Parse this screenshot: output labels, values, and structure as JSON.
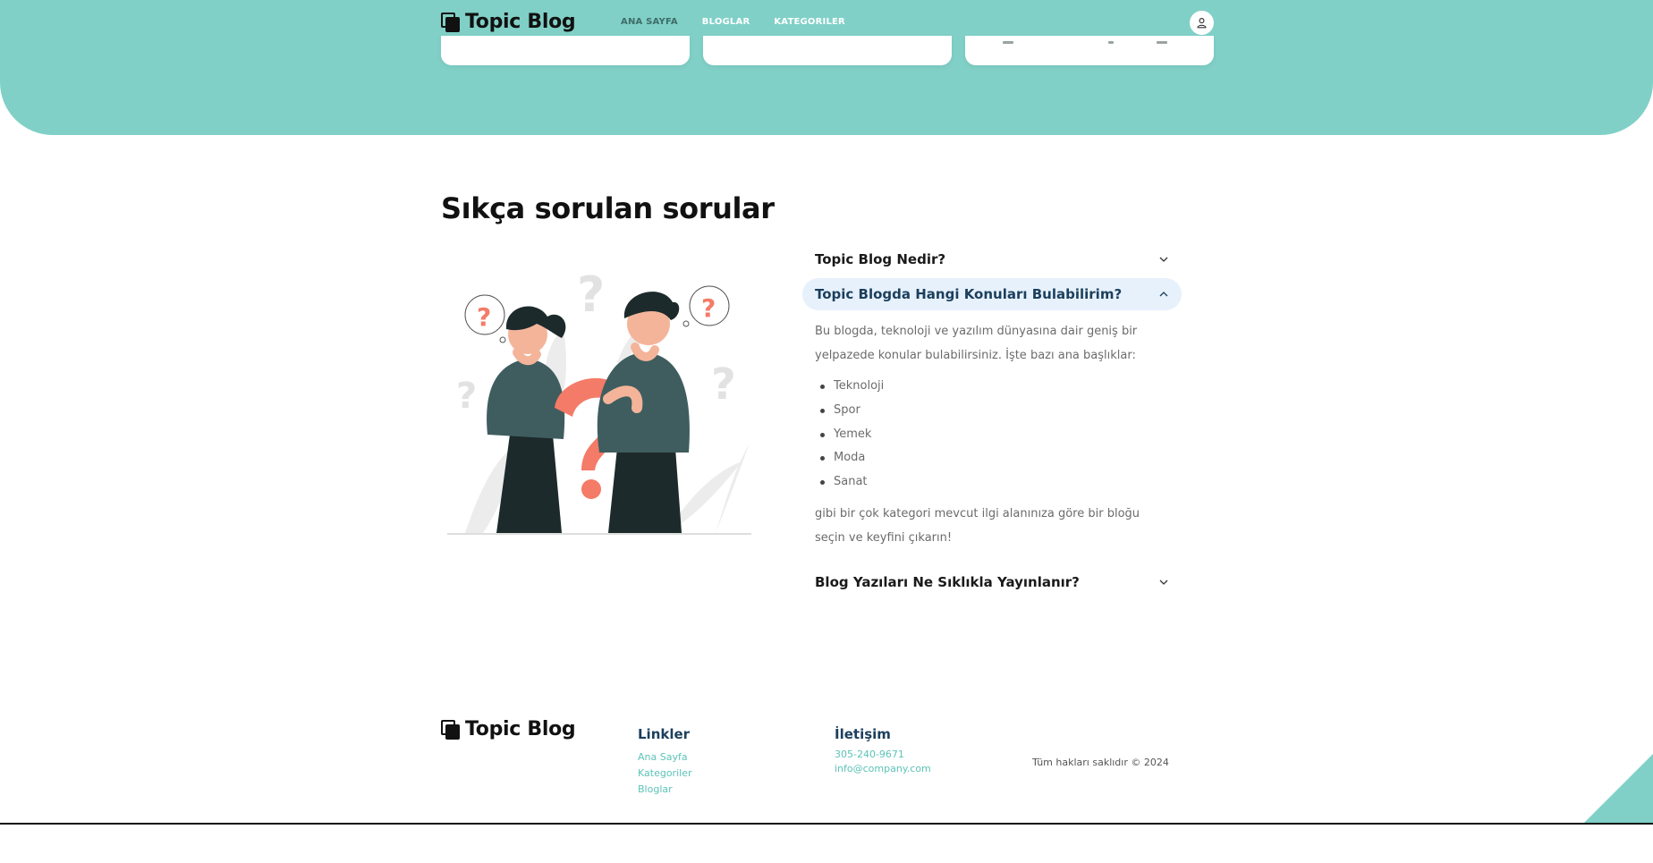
{
  "brand": {
    "name": "Topic Blog"
  },
  "nav": {
    "items": [
      {
        "label": "ANA SAYFA"
      },
      {
        "label": "BLOGLAR"
      },
      {
        "label": "KATEGORILER"
      }
    ]
  },
  "icons": {
    "user": "user-icon",
    "logo": "stacked-squares-icon",
    "chevron_down": "chevron-down-icon",
    "chevron_up": "chevron-up-icon"
  },
  "colors": {
    "accent": "#80d0c7",
    "link": "#5cc3b7",
    "heading": "#1b3f5c",
    "faq_open_bg": "#e7f1fc",
    "question_mark": "#f47b67"
  },
  "faq": {
    "title": "Sıkça sorulan sorular",
    "items": [
      {
        "question": "Topic Blog Nedir?",
        "open": false
      },
      {
        "question": "Topic Blogda Hangi Konuları Bulabilirim?",
        "open": true,
        "answer_intro": "Bu blogda, teknoloji ve yazılım dünyasına dair geniş bir yelpazede konular bulabilirsiniz. İşte bazı ana başlıklar:",
        "answer_list": [
          "Teknoloji",
          "Spor",
          "Yemek",
          "Moda",
          "Sanat"
        ],
        "answer_outro": "gibi bir çok kategori mevcut ilgi alanınıza göre bir bloğu seçin ve keyfini çıkarın!"
      },
      {
        "question": "Blog Yazıları Ne Sıklıkla Yayınlanır?",
        "open": false
      }
    ]
  },
  "footer": {
    "brand": "Topic Blog",
    "links_title": "Linkler",
    "links": [
      "Ana Sayfa",
      "Kategoriler",
      "Bloglar"
    ],
    "contact_title": "İletişim",
    "phone": "305-240-9671",
    "email": "info@company.com",
    "copyright": "Tüm hakları saklıdır © 2024"
  }
}
